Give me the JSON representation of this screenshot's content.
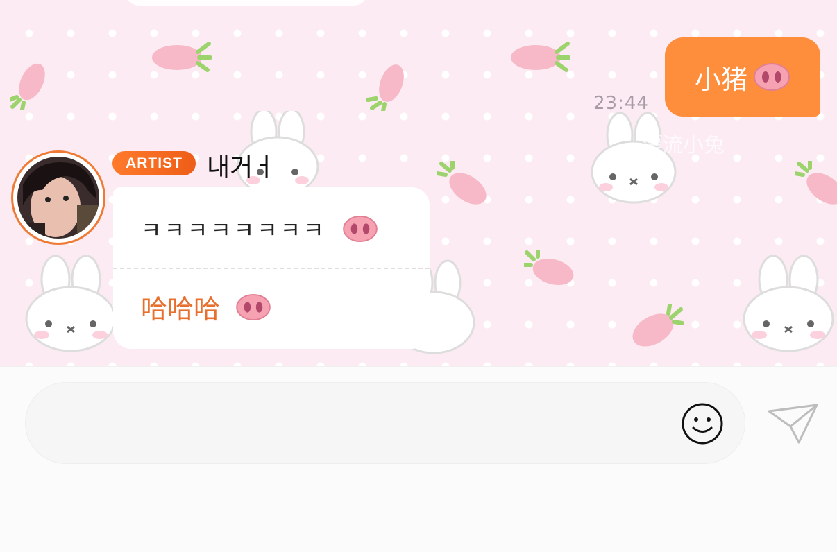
{
  "outgoing": {
    "text": "小猪",
    "time": "23:44"
  },
  "incoming": {
    "badge": "ARTIST",
    "sender": "내거ㅓ",
    "messages": [
      {
        "text": "ㅋㅋㅋㅋㅋㅋㅋㅋ"
      },
      {
        "text": "哈哈哈"
      }
    ]
  },
  "composer": {
    "placeholder": ""
  },
  "icons": {
    "pig_nose": "pig-nose-emoji",
    "emoji": "smiley-icon",
    "send": "paper-plane-icon"
  },
  "colors": {
    "accent": "#ff8e3c",
    "badge": "#ef5f19",
    "wallpaper": "#fcebf2",
    "in_text_zh": "#e8702e"
  }
}
